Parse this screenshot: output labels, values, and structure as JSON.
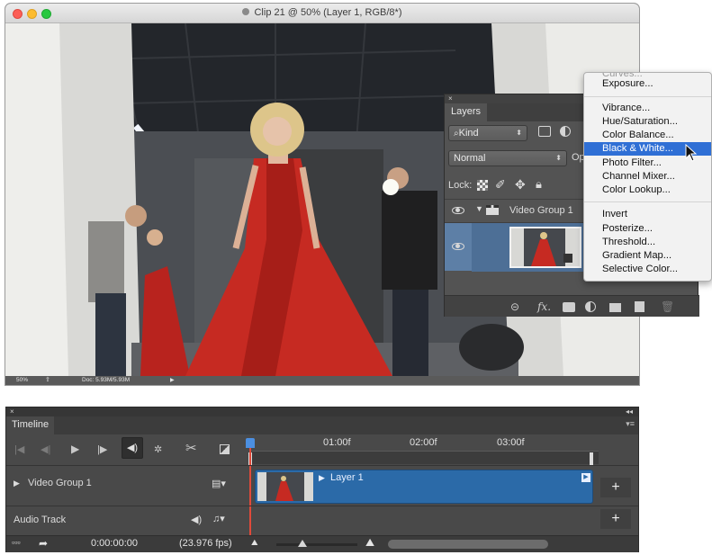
{
  "window": {
    "title": "Clip 21 @ 50% (Layer 1, RGB/8*)",
    "status_zoom": "50%",
    "status_doc": "Doc: 5.93M/5.93M"
  },
  "layers_panel": {
    "close_glyph": "×",
    "tab": "Layers",
    "filter_kind": "Kind",
    "blend_mode": "Normal",
    "opacity_label_partial": "Op",
    "lock_label": "Lock:",
    "group_name": "Video Group 1"
  },
  "adjustments_menu": {
    "items_top": [
      "Curves...",
      "Exposure..."
    ],
    "items_mid": [
      "Vibrance...",
      "Hue/Saturation...",
      "Color Balance...",
      "Black & White...",
      "Photo Filter...",
      "Channel Mixer...",
      "Color Lookup..."
    ],
    "items_bottom": [
      "Invert",
      "Posterize...",
      "Threshold...",
      "Gradient Map...",
      "Selective Color..."
    ],
    "selected": "Black & White..."
  },
  "timeline": {
    "close_glyph": "×",
    "tab": "Timeline",
    "ruler_labels": [
      "01:00f",
      "02:00f",
      "03:00f"
    ],
    "video_group": "Video Group 1",
    "audio_track": "Audio Track",
    "clip_label": "Layer 1",
    "timecode": "0:00:00:00",
    "fps": "(23.976 fps)"
  },
  "colors": {
    "menu_highlight": "#2f6fd5",
    "clip_blue": "#2b6aa8",
    "panel_bg": "#535353",
    "playhead": "#e04a3a"
  }
}
